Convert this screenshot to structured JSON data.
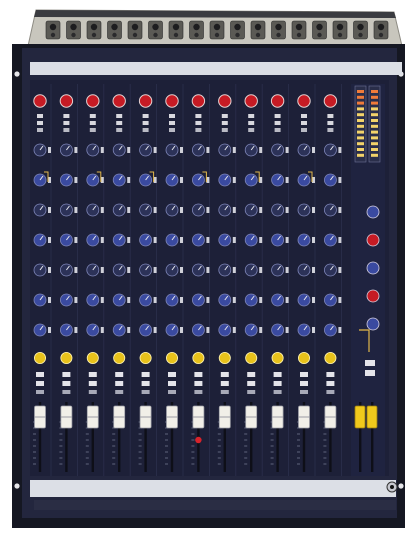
{
  "console": {
    "brand_text": "",
    "model_label": "",
    "colors": {
      "chassis": "#23263e",
      "panel": "#1d2038",
      "rack_ears": "#151722",
      "label_strip": "#dcdfe6",
      "rear_connectors": "#c8c6bd",
      "gain_knob": "#c61b24",
      "eq_knob": "#3a4aa0",
      "aux_knob": "#2c3258",
      "pan_knob": "#e8c21b",
      "fader_cap": "#f1efe8",
      "master_fader_cap": "#f0c91c",
      "meter_led": "#f3d36a"
    }
  },
  "channels": {
    "count": 12
  },
  "master_section": {
    "meter_count": 2,
    "master_fader_count": 2
  }
}
